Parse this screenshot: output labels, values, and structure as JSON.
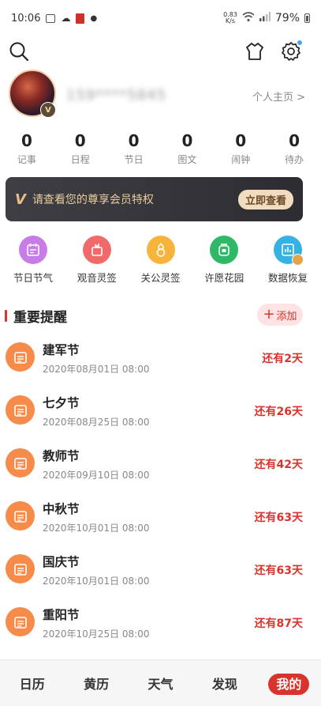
{
  "status_bar": {
    "time": "10:06",
    "net_speed_top": "0.83",
    "net_speed_bottom": "K/s",
    "battery": "79%"
  },
  "profile": {
    "username": "159****5845",
    "homepage_link": "个人主页 >",
    "vip_badge": "V"
  },
  "stats": [
    {
      "value": "0",
      "label": "记事"
    },
    {
      "value": "0",
      "label": "日程"
    },
    {
      "value": "0",
      "label": "节日"
    },
    {
      "value": "0",
      "label": "图文"
    },
    {
      "value": "0",
      "label": "闹钟"
    },
    {
      "value": "0",
      "label": "待办"
    }
  ],
  "vip_banner": {
    "icon": "V",
    "text": "请查看您的尊享会员特权",
    "button": "立即查看"
  },
  "shortcuts": [
    {
      "label": "节日节气",
      "icon": "calendar-icon",
      "color": "#c77ce8"
    },
    {
      "label": "观音灵签",
      "icon": "lottery-box-icon",
      "color": "#f06a6a"
    },
    {
      "label": "关公灵签",
      "icon": "gourd-icon",
      "color": "#f7b43a"
    },
    {
      "label": "许愿花园",
      "icon": "wish-jar-icon",
      "color": "#2fb866"
    },
    {
      "label": "数据恢复",
      "icon": "data-restore-icon",
      "color": "#35b1e3"
    }
  ],
  "reminders_section": {
    "title": "重要提醒",
    "add_button": "添加"
  },
  "reminders": [
    {
      "name": "建军节",
      "date": "2020年08月01日  08:00",
      "remaining": "还有2天"
    },
    {
      "name": "七夕节",
      "date": "2020年08月25日  08:00",
      "remaining": "还有26天"
    },
    {
      "name": "教师节",
      "date": "2020年09月10日  08:00",
      "remaining": "还有42天"
    },
    {
      "name": "中秋节",
      "date": "2020年10月01日  08:00",
      "remaining": "还有63天"
    },
    {
      "name": "国庆节",
      "date": "2020年10月01日  08:00",
      "remaining": "还有63天"
    },
    {
      "name": "重阳节",
      "date": "2020年10月25日  08:00",
      "remaining": "还有87天"
    }
  ],
  "tabbar": [
    {
      "label": "日历",
      "active": false
    },
    {
      "label": "黄历",
      "active": false
    },
    {
      "label": "天气",
      "active": false
    },
    {
      "label": "发现",
      "active": false
    },
    {
      "label": "我的",
      "active": true
    }
  ],
  "colors": {
    "accent": "#d9342b",
    "reminder_icon": "#f68b4a",
    "vip_gold": "#e7c089"
  }
}
